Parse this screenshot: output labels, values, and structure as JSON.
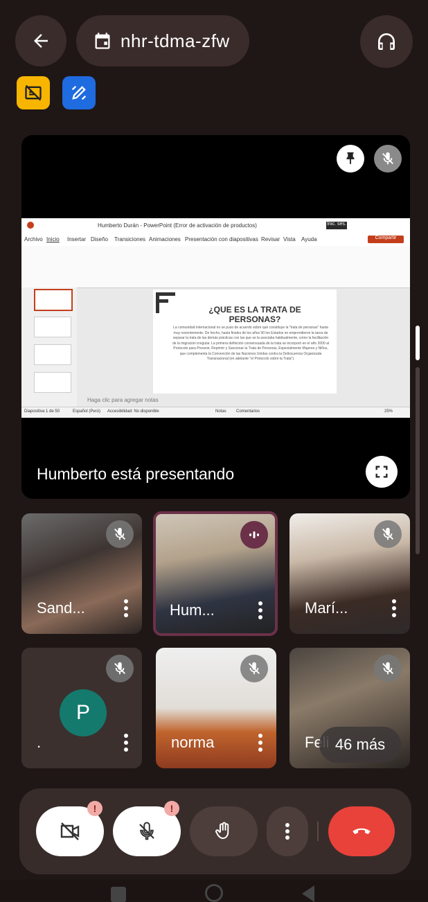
{
  "header": {
    "meeting_code": "nhr-tdma-zfw",
    "back_icon": "arrow-left-icon",
    "calendar_icon": "calendar-icon",
    "audio_icon": "headphones-icon"
  },
  "badges": [
    {
      "icon": "no-captions-icon",
      "color": "#f7b500"
    },
    {
      "icon": "whiteboard-icon",
      "color": "#1f6be0"
    }
  ],
  "presentation": {
    "caption": "Humberto está presentando",
    "ppt": {
      "window_title": "Humberto Durán - PowerPoint (Error de activación de productos)",
      "menu": [
        "Archivo",
        "Inicio",
        "Insertar",
        "Diseño",
        "Transiciones",
        "Animaciones",
        "Presentación con diapositivas",
        "Revisar",
        "Vista",
        "Ayuda"
      ],
      "share": "Compartir",
      "slide_title": "¿QUE ES LA TRATA DE PERSONAS?",
      "slide_body": "La comunidad internacional no se puso de acuerdo sobre qué constituye la \"trata de personas\" hasta muy recientemente. De hecho, hasta finales de los años 90 los Estados no emprendieron la tarea de separar la trata de las demás prácticas con las que se la asociaba habitualmente, como la facilitación de la migración irregular. La primera definición consensuada de la trata se incorporó en el año 2000 al Protocolo para Prevenir, Reprimir y Sancionar la Trata de Personas, Especialmente Mujeres y Niños, que complementa la Convención de las Naciones Unidas contra la Delincuencia Organizada Transnacional (en adelante \"el Protocolo sobre la Trata\").",
      "notes_placeholder": "Haga clic para agregar notas",
      "status_left": "Diapositiva 1 de 50",
      "status_lang": "Español (Perú)",
      "status_access": "Accesibilidad: No disponible",
      "status_notes": "Notas",
      "status_comments": "Comentarios",
      "zoom": "25%"
    }
  },
  "participants": [
    {
      "name": "Sand...",
      "muted": true
    },
    {
      "name": "Hum...",
      "speaking": true
    },
    {
      "name": "Marí...",
      "muted": true
    },
    {
      "name": ".",
      "avatar_letter": "P",
      "muted": true
    },
    {
      "name": "norma",
      "muted": true
    },
    {
      "name": "Feli",
      "muted": true
    }
  ],
  "more_participants": "46 más",
  "controls": {
    "camera_icon": "camera-off-icon",
    "mic_icon": "mic-off-icon",
    "hand_icon": "raise-hand-icon",
    "more_icon": "more-vert-icon",
    "end_icon": "end-call-icon",
    "alert": "!"
  }
}
